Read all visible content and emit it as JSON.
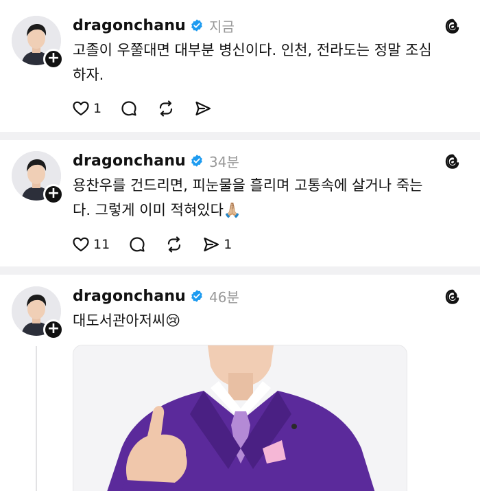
{
  "posts": [
    {
      "username": "dragonchanu",
      "time": "지금",
      "text_line1": "고졸이 우쭐대면 대부분 병신이다. 인천, 전라도는 정말 조심",
      "text_line2": "하자.",
      "likes": "1",
      "reposts": "",
      "shares": ""
    },
    {
      "username": "dragonchanu",
      "time": "34분",
      "text_line1": "용찬우를 건드리면, 피눈물을 흘리며 고통속에 살거나 죽는",
      "text_line2": "다. 그렇게 이미 적혀있다🙏🏼",
      "likes": "11",
      "reposts": "",
      "shares": "1"
    },
    {
      "username": "dragonchanu",
      "time": "46분",
      "text_line1": "대도서관아저씨😢",
      "text_line2": "",
      "likes": "",
      "reposts": "",
      "shares": ""
    }
  ],
  "icons": {
    "verified": "verified-badge-icon",
    "threads": "threads-logo-icon",
    "follow": "plus-icon",
    "like": "heart-icon",
    "comment": "comment-icon",
    "repost": "repost-icon",
    "share": "send-icon"
  },
  "colors": {
    "verified": "#1d9bf0",
    "time": "#999999",
    "suit": "#5b2a9b",
    "divider": "#f1f1f3"
  },
  "follow_symbol": "+"
}
